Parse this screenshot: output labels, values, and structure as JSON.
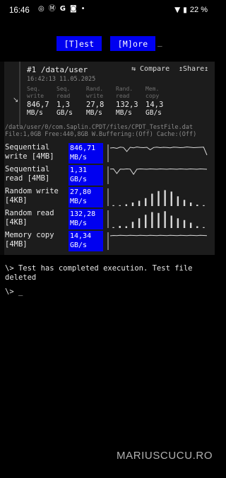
{
  "status_bar": {
    "time": "16:46",
    "icons": [
      "whatsapp-icon",
      "motorola-icon",
      "google-icon",
      "instagram-icon",
      "dot-icon"
    ],
    "battery": "22 %"
  },
  "top_buttons": {
    "test_label": "[T]est",
    "more_label": "[M]ore",
    "cursor": "_"
  },
  "result": {
    "title": "#1 /data/user",
    "date": "16:42:13 11.05.2025",
    "compare_label": "⇆ Compare",
    "share_label": "↥Share↥",
    "summary": [
      {
        "head1": "Seq.",
        "head2": "write",
        "value": "846,7",
        "unit": "MB/s"
      },
      {
        "head1": "Seq.",
        "head2": "read",
        "value": "1,3",
        "unit": "GB/s"
      },
      {
        "head1": "Rand.",
        "head2": "write",
        "value": "27,8",
        "unit": "MB/s"
      },
      {
        "head1": "Rand.",
        "head2": "read",
        "value": "132,3",
        "unit": "MB/s"
      },
      {
        "head1": "Mem.",
        "head2": "copy",
        "value": "14,3",
        "unit": "GB/s"
      }
    ]
  },
  "file": {
    "path": "/data/user/0/com.Saplin.CPDT/files/CPDT_TestFile.dat",
    "info": "File:1,0GB Free:440,8GB W.Buffering:(Off) Cache:(Off)"
  },
  "benchmarks": [
    {
      "label1": "Sequential",
      "label2": "write [4MB]",
      "value": "846,71",
      "unit": "MB/s",
      "graph": "line-dips",
      "samples": [
        0.8,
        0.82,
        0.78,
        0.85,
        0.83,
        0.6,
        0.84,
        0.81,
        0.86,
        0.83,
        0.82,
        0.84,
        0.7,
        0.83,
        0.85,
        0.82,
        0.84,
        0.83,
        0.81,
        0.85,
        0.84,
        0.82,
        0.83,
        0.86,
        0.84,
        0.82,
        0.83,
        0.84,
        0.85,
        0.4
      ]
    },
    {
      "label1": "Sequential",
      "label2": "read [4MB]",
      "value": "1,31",
      "unit": "GB/s",
      "graph": "line-dips",
      "samples": [
        0.85,
        0.86,
        0.6,
        0.85,
        0.84,
        0.86,
        0.85,
        0.55,
        0.84,
        0.86,
        0.85,
        0.84,
        0.86,
        0.85,
        0.84,
        0.86,
        0.85,
        0.84,
        0.86,
        0.85,
        0.84,
        0.86,
        0.85,
        0.84,
        0.86,
        0.85,
        0.84,
        0.86,
        0.85,
        0.84
      ]
    },
    {
      "label1": "Random write",
      "label2": "[4KB]",
      "value": "27,80",
      "unit": "MB/s",
      "graph": "bars",
      "samples": [
        0.05,
        0.05,
        0.1,
        0.2,
        0.3,
        0.45,
        0.7,
        0.85,
        0.9,
        0.82,
        0.55,
        0.35,
        0.2,
        0.08,
        0.05
      ]
    },
    {
      "label1": "Random read",
      "label2": "[4KB]",
      "value": "132,28",
      "unit": "MB/s",
      "graph": "bars",
      "samples": [
        0.05,
        0.12,
        0.1,
        0.35,
        0.55,
        0.75,
        0.9,
        0.85,
        0.95,
        0.7,
        0.55,
        0.45,
        0.3,
        0.1,
        0.05
      ]
    },
    {
      "label1": "Memory copy",
      "label2": "[4MB]",
      "value": "14,34",
      "unit": "GB/s",
      "graph": "line-dips",
      "samples": [
        0.8,
        0.82,
        0.81,
        0.83,
        0.82,
        0.81,
        0.83,
        0.82,
        0.81,
        0.83,
        0.82,
        0.81,
        0.83,
        0.82,
        0.81,
        0.83,
        0.82,
        0.81,
        0.83,
        0.82,
        0.81,
        0.83,
        0.82,
        0.81,
        0.83,
        0.82,
        0.81,
        0.83,
        0.82,
        0.81
      ]
    }
  ],
  "terminal": {
    "line1": "\\> Test has completed execution. Test file",
    "line2": "deleted",
    "prompt": "\\> _"
  },
  "watermark": "MARIUSCUCU.RO"
}
